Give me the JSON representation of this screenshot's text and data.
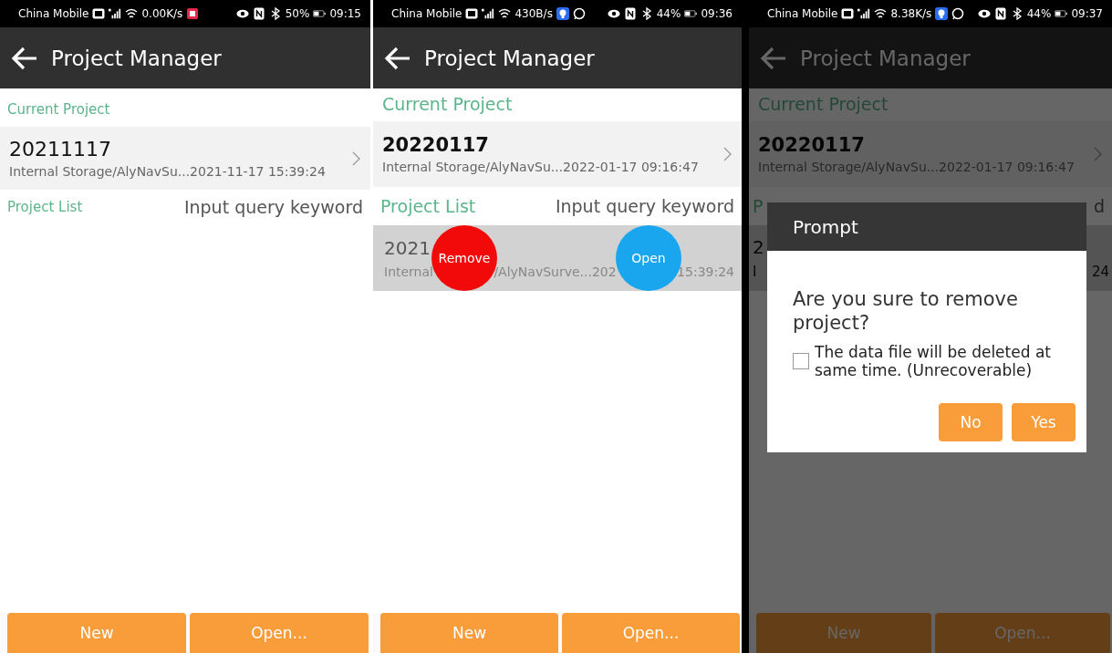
{
  "screens": [
    {
      "status_bar": {
        "carrier": "China Mobile",
        "speed": "0.00K/s",
        "battery": "50%",
        "time": "09:15",
        "notifications": [
          {
            "kind": "record"
          }
        ]
      },
      "title": "Project Manager",
      "current_section": "Current Project",
      "current_project": {
        "name": "20211117",
        "path": "Internal Storage/AlyNavSu...2021-11-17 15:39:24"
      },
      "list_section": {
        "label": "Project List",
        "placeholder": "Input query keyword"
      },
      "buttons": [
        "New",
        "Open..."
      ]
    },
    {
      "status_bar": {
        "carrier": "China Mobile",
        "speed": "430B/s",
        "battery": "44%",
        "time": "09:36",
        "notifications": [
          {
            "kind": "bulb"
          },
          {
            "kind": "chat"
          }
        ]
      },
      "title": "Project Manager",
      "current_section": "Current Project",
      "current_project": {
        "name": "20220117",
        "path": "Internal Storage/AlyNavSu...2022-01-17 09:16:47"
      },
      "list_section": {
        "label": "Project List",
        "placeholder": "Input query keyword"
      },
      "projects": [
        {
          "name": "2021",
          "path_parts": [
            "Internal",
            "/AlyNavSurve...202",
            "15:39:24"
          ],
          "highlighted": true,
          "swipe_actions": [
            {
              "label": "Remove",
              "kind": "remove"
            },
            {
              "label": "Open",
              "kind": "open"
            }
          ]
        }
      ],
      "buttons": [
        "New",
        "Open..."
      ]
    },
    {
      "status_bar": {
        "carrier": "China Mobile",
        "speed": "8.38K/s",
        "battery": "44%",
        "time": "09:37",
        "notifications": [
          {
            "kind": "bulb"
          },
          {
            "kind": "chat"
          }
        ]
      },
      "title": "Project Manager",
      "current_section": "Current Project",
      "current_project": {
        "name": "20220117",
        "path": "Internal Storage/AlyNavSu...2022-01-17 09:16:47"
      },
      "list_section": {
        "label": "P",
        "placeholder": "d"
      },
      "projects": [
        {
          "name": "2",
          "path_parts": [
            "I",
            "24"
          ],
          "highlighted": true
        }
      ],
      "buttons": [
        "New",
        "Open..."
      ],
      "dialog": {
        "title": "Prompt",
        "message": "Are you sure to remove project?",
        "checkbox": {
          "label": "The data file will be deleted at same time. (Unrecoverable)",
          "checked": false
        },
        "buttons": [
          "No",
          "Yes"
        ]
      }
    }
  ]
}
